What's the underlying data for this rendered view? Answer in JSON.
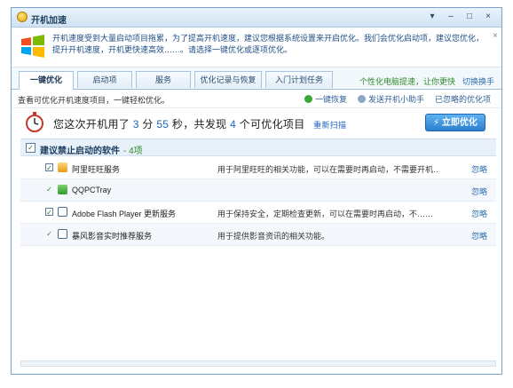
{
  "window": {
    "title": "开机加速",
    "controls": [
      "▾",
      "–",
      "□",
      "×"
    ]
  },
  "banner": {
    "text": "开机速度受到大量启动项目拖累，为了提高开机速度，建议您根据系统设置来开启优化。我们会优化启动项，建议您优化，提升开机速度，开机更快速高效……。请选择一键优化或逐项优化。",
    "close": "×"
  },
  "tabs": [
    {
      "label": "一键优化",
      "active": true
    },
    {
      "label": "启动项",
      "active": false
    },
    {
      "label": "服务",
      "active": false
    },
    {
      "label": "优化记录与恢复",
      "active": false
    },
    {
      "label": "入门计划任务",
      "active": false
    }
  ],
  "tab_links": {
    "link1": "个性化电脑提速，让你更快",
    "link2": "切换换手"
  },
  "toolbar": {
    "description": "查看可优化开机速度项目，一键轻松优化。",
    "action1": "一键恢复",
    "action2": "发送开机小助手",
    "action3": "已忽略的优化项"
  },
  "summary": {
    "prefix": "您这次开机用了",
    "minutes": "3",
    "min_unit": "分",
    "seconds": "55",
    "sec_unit": "秒，共发现",
    "count": "4",
    "suffix": "个可优化项目",
    "link": "重新扫描",
    "button": "立即优化"
  },
  "group": {
    "title": "建议禁止启动的软件",
    "count": "- 4项"
  },
  "rows": [
    {
      "name": "阿里旺旺服务",
      "desc": "用于阿里旺旺的相关功能，可以在需要时再启动，不需要开机……",
      "action": "忽略"
    },
    {
      "name": "QQPCTray",
      "desc": "",
      "action": "忽略"
    },
    {
      "name": "Adobe Flash Player 更新服务",
      "desc": "用于保持安全，定期检查更新，可以在需要时再启动，不……",
      "action": "忽略"
    },
    {
      "name": "暴风影音实时推荐服务",
      "desc": "用于提供影音资讯的相关功能。",
      "action": "忽略"
    }
  ],
  "colors": {
    "accent": "#2b7fd0",
    "link": "#2f6fb0",
    "green": "#2e8a2a",
    "header_bg": "#e8f1fa"
  }
}
